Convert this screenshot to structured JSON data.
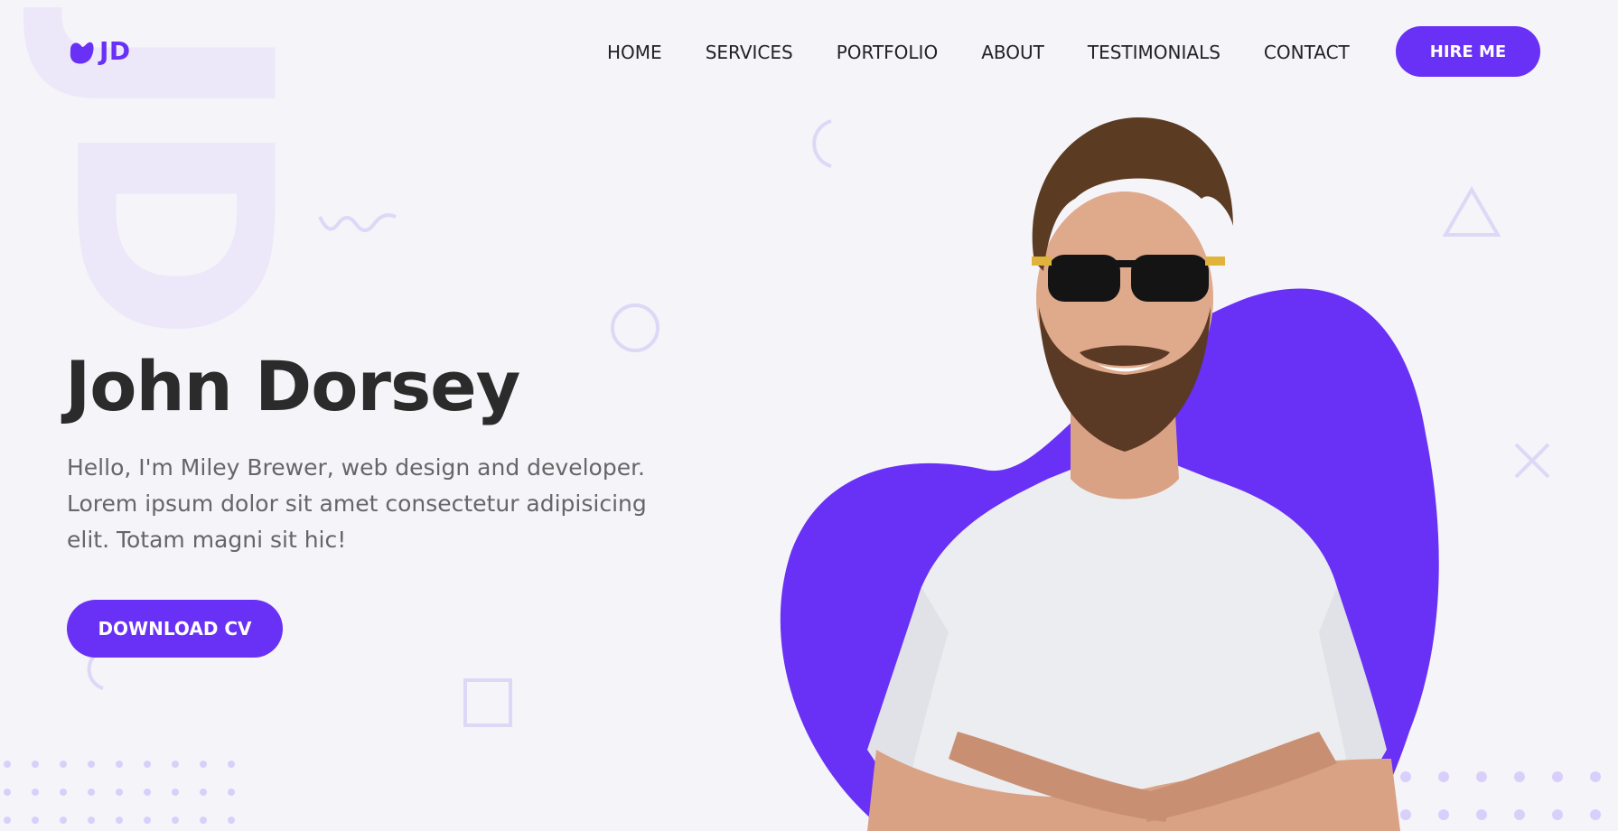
{
  "brand": {
    "logo_text": "JD",
    "watermark_text": "JD",
    "accent_color": "#6930f5"
  },
  "nav": {
    "items": [
      {
        "label": "HOME"
      },
      {
        "label": "SERVICES"
      },
      {
        "label": "PORTFOLIO"
      },
      {
        "label": "ABOUT"
      },
      {
        "label": "TESTIMONIALS"
      },
      {
        "label": "CONTACT"
      }
    ],
    "cta_label": "HIRE ME"
  },
  "hero": {
    "title": "John Dorsey",
    "description": "Hello, I'm Miley Brewer, web design and developer. Lorem ipsum dolor sit amet consectetur adipisicing elit. Totam magni sit hic!",
    "cta_label": "DOWNLOAD CV",
    "image_icon": "portrait-photo"
  }
}
